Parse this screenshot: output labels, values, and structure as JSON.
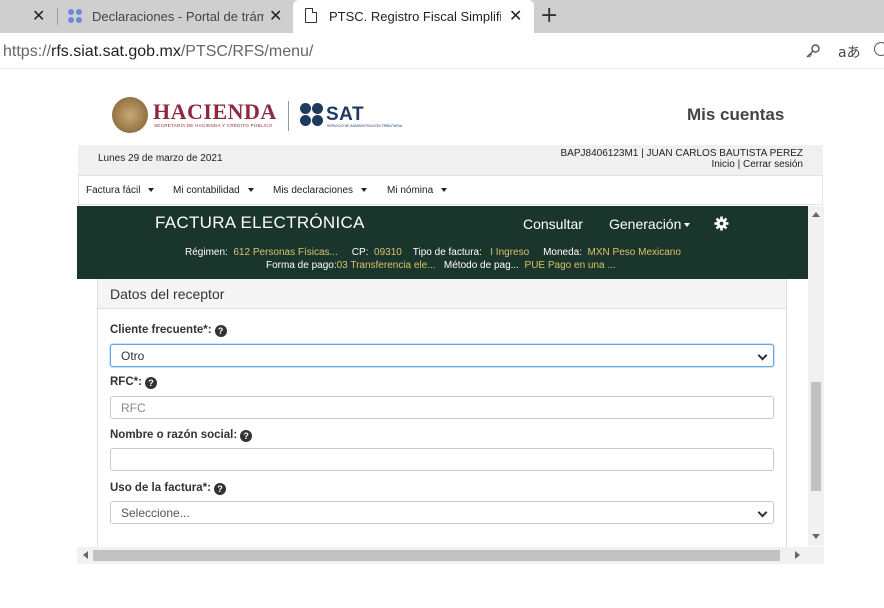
{
  "browser": {
    "tabs": [
      {
        "title": "Declaraciones - Portal de trámites"
      },
      {
        "title": "PTSC. Registro Fiscal Simplificado"
      }
    ],
    "url_host": "rfs.siat.sat.gob.mx",
    "url_prefix": "https://",
    "url_path": "/PTSC/RFS/menu/",
    "read_aloud_glyph": "aあ"
  },
  "header": {
    "hacienda": "HACIENDA",
    "hacienda_sub": "SECRETARÍA DE HACIENDA Y CRÉDITO PÚBLICO",
    "sat": "SAT",
    "sat_sub": "SERVICIO DE ADMINISTRACIÓN TRIBUTARIA",
    "mis_cuentas": "Mis cuentas"
  },
  "infobar": {
    "date": "Lunes 29 de marzo de 2021",
    "user": "BAPJ8406123M1 | JUAN CARLOS BAUTISTA PEREZ",
    "inicio": "Inicio",
    "separator": "|",
    "cerrar": "Cerrar sesión"
  },
  "menu": [
    {
      "label": "Factura fácil"
    },
    {
      "label": "Mi contabilidad"
    },
    {
      "label": "Mis declaraciones"
    },
    {
      "label": "Mi nómina"
    }
  ],
  "fe": {
    "title": "FACTURA ELECTRÓNICA",
    "consultar": "Consultar",
    "generacion": "Generación",
    "regimen_label": "Régimen:",
    "regimen": "612 Personas Físicas...",
    "cp_label": "CP:",
    "cp": "09310",
    "tipo_label": "Tipo de factura:",
    "tipo": "I Ingreso",
    "moneda_label": "Moneda:",
    "moneda": "MXN Peso Mexicano",
    "forma_label": "Forma de pago:",
    "forma": "03 Transferencia ele...",
    "metodo_label": "Método de pag...",
    "metodo": "PUE Pago en una ..."
  },
  "form": {
    "section_title": "Datos del receptor",
    "cliente_label": "Cliente frecuente*:",
    "cliente_value": "Otro",
    "rfc_label": "RFC*:",
    "rfc_placeholder": "RFC",
    "nombre_label": "Nombre o razón social:",
    "nombre_value": "",
    "uso_label": "Uso de la factura*:",
    "uso_value": "Seleccione..."
  },
  "icons": {
    "help": "?"
  }
}
